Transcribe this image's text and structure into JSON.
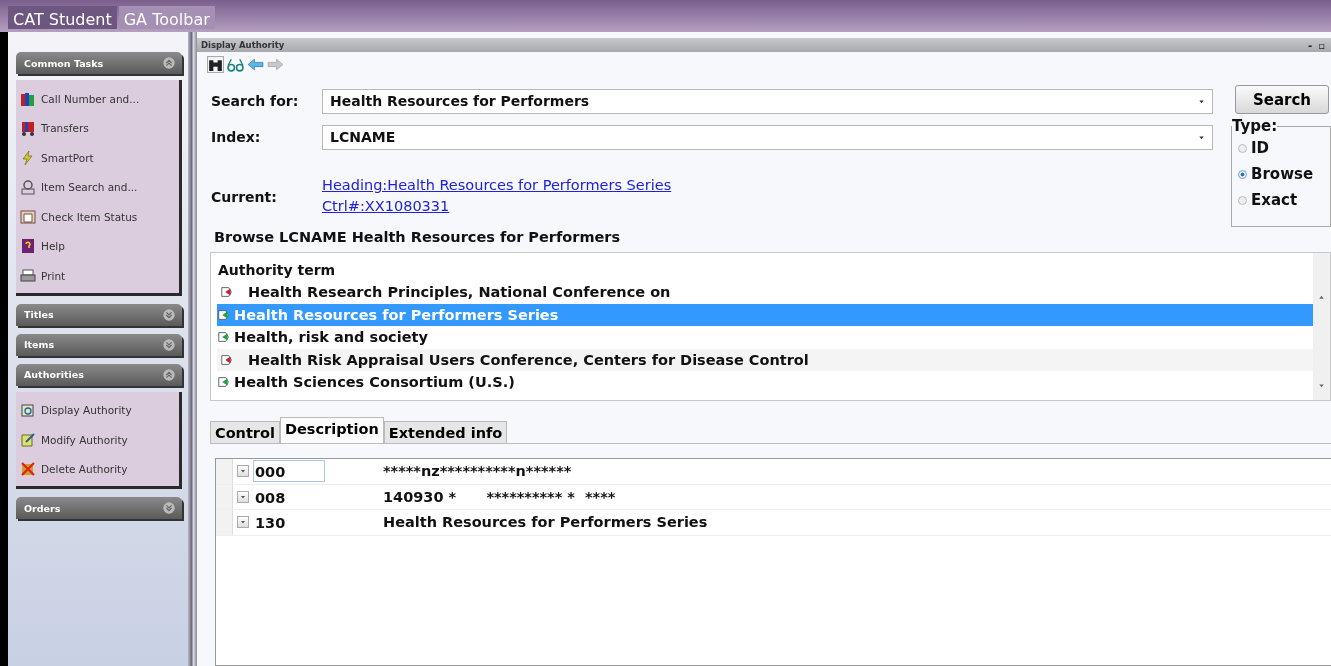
{
  "app_tabs": [
    {
      "label": "CAT Student",
      "selected": true
    },
    {
      "label": "GA Toolbar",
      "selected": false
    }
  ],
  "sidebar": {
    "groups": [
      {
        "title": "Common Tasks",
        "expanded": true,
        "items": [
          {
            "label": "Call Number and..."
          },
          {
            "label": "Transfers"
          },
          {
            "label": "SmartPort"
          },
          {
            "label": "Item Search and..."
          },
          {
            "label": "Check Item Status"
          },
          {
            "label": "Help"
          },
          {
            "label": "Print"
          }
        ]
      },
      {
        "title": "Titles",
        "expanded": false
      },
      {
        "title": "Items",
        "expanded": false
      },
      {
        "title": "Authorities",
        "expanded": true,
        "items": [
          {
            "label": "Display Authority"
          },
          {
            "label": "Modify Authority"
          },
          {
            "label": "Delete Authority"
          }
        ]
      },
      {
        "title": "Orders",
        "expanded": false
      }
    ]
  },
  "window": {
    "title": "Display Authority",
    "controls": [
      "-",
      "▫"
    ]
  },
  "search": {
    "label": "Search for:",
    "value": "Health Resources for Performers",
    "button": "Search"
  },
  "index": {
    "label": "Index:",
    "value": "LCNAME"
  },
  "current": {
    "label": "Current:",
    "links": [
      "Heading:Health Resources for Performers Series",
      "Ctrl#:XX1080331"
    ]
  },
  "type_group": {
    "legend": "Type:",
    "options": [
      {
        "label": "ID",
        "selected": false
      },
      {
        "label": "Browse",
        "selected": true
      },
      {
        "label": "Exact",
        "selected": false
      }
    ]
  },
  "browse": {
    "title": "Browse LCNAME Health Resources for Performers",
    "column": "Authority term",
    "rows": [
      {
        "term": "Health Research Principles, National Conference on",
        "kind": "reference",
        "selected": false
      },
      {
        "term": "Health Resources for Performers Series",
        "kind": "heading",
        "selected": true
      },
      {
        "term": "Health, risk and society",
        "kind": "heading",
        "selected": false
      },
      {
        "term": "Health Risk Appraisal Users Conference, Centers for Disease Control",
        "kind": "reference",
        "selected": false
      },
      {
        "term": "Health Sciences Consortium (U.S.)",
        "kind": "heading",
        "selected": false
      }
    ]
  },
  "detail_tabs": [
    {
      "label": "Control",
      "selected": false
    },
    {
      "label": "Description",
      "selected": true
    },
    {
      "label": "Extended info",
      "selected": false
    }
  ],
  "fields": [
    {
      "tag": "000",
      "value": "*****nz**********n******",
      "selected": true
    },
    {
      "tag": "008",
      "value": "140930 *      ********** *  ****",
      "selected": false
    },
    {
      "tag": "130",
      "value": "Health Resources for Performers Series",
      "selected": false
    }
  ]
}
